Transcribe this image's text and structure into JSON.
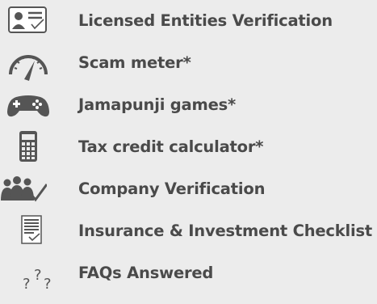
{
  "colors": {
    "background": "#ececec",
    "text": "#4a4a4a",
    "icon_dark": "#555555",
    "icon_light": "#ffffff"
  },
  "menu": {
    "items": [
      {
        "label": "Licensed Entities Verification",
        "icon": "id-card-check-icon"
      },
      {
        "label": "Scam meter*",
        "icon": "speedometer-icon"
      },
      {
        "label": "Jamapunji games*",
        "icon": "gamepad-icon"
      },
      {
        "label": "Tax credit calculator*",
        "icon": "calculator-icon"
      },
      {
        "label": "Company Verification",
        "icon": "people-check-icon"
      },
      {
        "label": "Insurance & Investment Checklist",
        "icon": "checklist-document-icon"
      },
      {
        "label": "FAQs Answered",
        "icon": "question-marks-icon"
      }
    ]
  }
}
